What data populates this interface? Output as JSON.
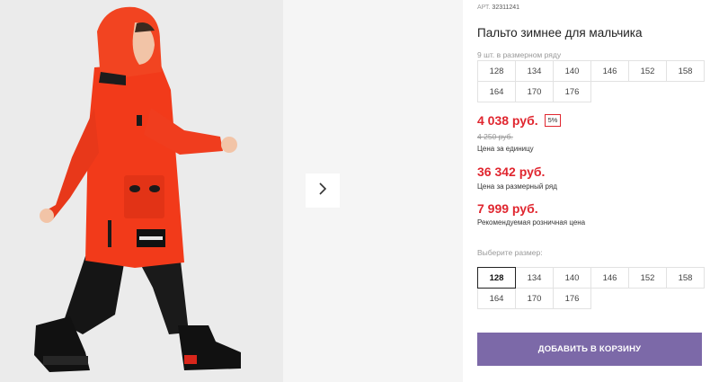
{
  "product": {
    "sku_label": "АРТ.",
    "sku": "32311241",
    "title": "Пальто зимнее для мальчика"
  },
  "pack": {
    "label": "9 шт. в размерном ряду",
    "sizes": [
      "128",
      "134",
      "140",
      "146",
      "152",
      "158",
      "164",
      "170",
      "176"
    ]
  },
  "prices": {
    "unit_price": "4 038 руб.",
    "discount": "5%",
    "old_price": "4 250 руб.",
    "unit_label": "Цена за единицу",
    "pack_price": "36 342 руб.",
    "pack_label": "Цена за размерный ряд",
    "rrp": "7 999 руб.",
    "rrp_label": "Рекомендуемая розничная цена"
  },
  "size_picker": {
    "label": "Выберите размер:",
    "selected": "128",
    "sizes": [
      "128",
      "134",
      "140",
      "146",
      "152",
      "158",
      "164",
      "170",
      "176"
    ]
  },
  "actions": {
    "add_to_cart": "ДОБАВИТЬ В КОРЗИНУ"
  },
  "icons": {
    "next": "chevron-right-icon"
  },
  "colors": {
    "price": "#e0262f",
    "button": "#7c69a8",
    "coat": "#f23a1a"
  }
}
